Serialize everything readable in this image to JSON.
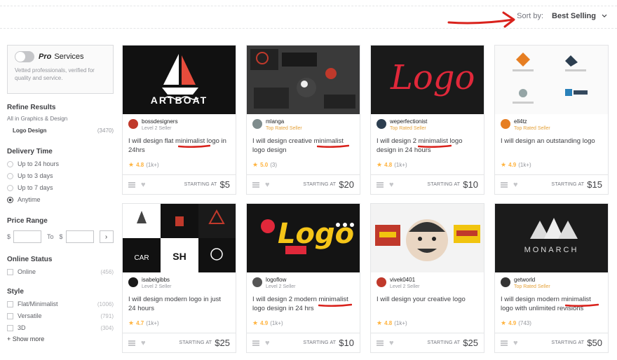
{
  "sort": {
    "label": "Sort by:",
    "value": "Best Selling"
  },
  "sidebar": {
    "pro": {
      "logo": "Pro",
      "label": "Services",
      "description": "Vetted professionals, verified for quality and service."
    },
    "refine_title": "Refine Results",
    "breadcrumb": "All in Graphics & Design",
    "category": {
      "name": "Logo Design",
      "count": "(3470)"
    },
    "delivery": {
      "title": "Delivery Time",
      "options": [
        {
          "label": "Up to 24 hours",
          "selected": false
        },
        {
          "label": "Up to 3 days",
          "selected": false
        },
        {
          "label": "Up to 7 days",
          "selected": false
        },
        {
          "label": "Anytime",
          "selected": true
        }
      ]
    },
    "price": {
      "title": "Price Range",
      "currency": "$",
      "to_label": "To",
      "go": "›"
    },
    "online": {
      "title": "Online Status",
      "label": "Online",
      "count": "(456)"
    },
    "style": {
      "title": "Style",
      "options": [
        {
          "label": "Flat/Minimalist",
          "count": "(1006)"
        },
        {
          "label": "Versatile",
          "count": "(791)"
        },
        {
          "label": "3D",
          "count": "(304)"
        }
      ],
      "show_more": "+ Show more"
    }
  },
  "starting_at": "STARTING AT",
  "gigs": [
    {
      "seller": "bossdesigners",
      "level": "Level 2 Seller",
      "top": false,
      "title": "I will design flat minimalist logo in 24hrs",
      "rating": "4.8",
      "count": "(1k+)",
      "price": "$5",
      "thumb_text": "ARTBOAT",
      "avatar": "#c0392b"
    },
    {
      "seller": "mlanga",
      "level": "Top Rated Seller",
      "top": true,
      "title": "I will design creative minimalist logo design",
      "rating": "5.0",
      "count": "(3)",
      "price": "$20",
      "thumb_text": "",
      "avatar": "#7f8c8d"
    },
    {
      "seller": "weperfectionist",
      "level": "Top Rated Seller",
      "top": true,
      "title": "I will design 2 minimalist logo design in 24 hours",
      "rating": "4.8",
      "count": "(1k+)",
      "price": "$10",
      "thumb_text": "Logo",
      "avatar": "#2c3e50"
    },
    {
      "seller": "ell4tz",
      "level": "Top Rated Seller",
      "top": true,
      "title": "I will design an outstanding logo",
      "rating": "4.9",
      "count": "(1k+)",
      "price": "$15",
      "thumb_text": "",
      "avatar": "#e67e22"
    },
    {
      "seller": "isabelgibbs",
      "level": "Level 2 Seller",
      "top": false,
      "title": "I will design modern logo in just 24 hours",
      "rating": "4.7",
      "count": "(1k+)",
      "price": "$25",
      "thumb_text": "",
      "avatar": "#1a1a1a"
    },
    {
      "seller": "logoflow",
      "level": "Level 2 Seller",
      "top": false,
      "title": "I will design 2 modern minimalist logo design in 24 hrs",
      "rating": "4.9",
      "count": "(1k+)",
      "price": "$10",
      "thumb_text": "Logo",
      "avatar": "#555555"
    },
    {
      "seller": "vivek0401",
      "level": "Level 2 Seller",
      "top": false,
      "title": "I will design your creative logo",
      "rating": "4.8",
      "count": "(1k+)",
      "price": "$25",
      "thumb_text": "",
      "avatar": "#c0392b"
    },
    {
      "seller": "getworld",
      "level": "Top Rated Seller",
      "top": true,
      "title": "I will design modern minimalist logo with unlimited revisions",
      "rating": "4.9",
      "count": "(743)",
      "price": "$50",
      "thumb_text": "MONARCH",
      "avatar": "#333333"
    }
  ],
  "colors": {
    "accent_red": "#d9221c",
    "star": "#ffb33e",
    "top_rated": "#e5a23a"
  }
}
